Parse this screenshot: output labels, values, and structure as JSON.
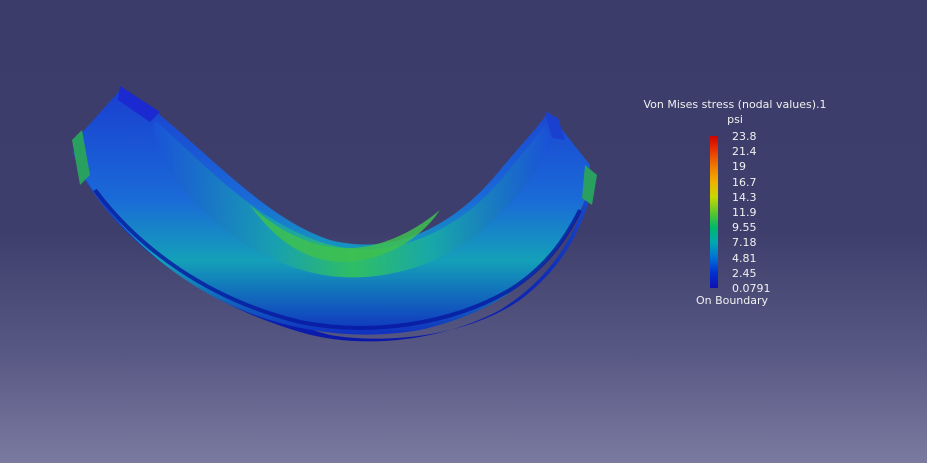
{
  "legend": {
    "title": "Von Mises stress (nodal values).1",
    "unit": "psi",
    "values": [
      "23.8",
      "21.4",
      "19",
      "16.7",
      "14.3",
      "11.9",
      "9.55",
      "7.18",
      "4.81",
      "2.45",
      "0.0791"
    ],
    "footer": "On Boundary"
  },
  "colors": {
    "background_top": "#3c3c6a",
    "background_bottom": "#7a7aa0",
    "scale_max": "#d00000",
    "scale_mid": "#60c828",
    "scale_min": "#1010b0"
  }
}
